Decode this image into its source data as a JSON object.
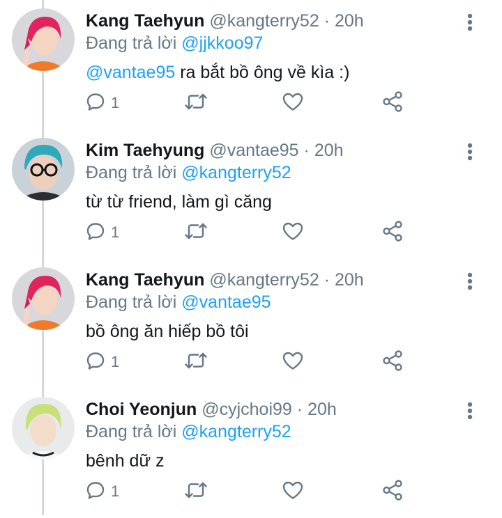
{
  "colors": {
    "text": "#14171a",
    "secondary": "#657786",
    "mention": "#1da1f2",
    "thread_line": "#cfd9de",
    "icon": "#657786"
  },
  "tweets": [
    {
      "name": "Kang Taehyun",
      "handle": "@kangterry52",
      "dot": "·",
      "time": "20h",
      "reply_prefix": "Đang trả lời",
      "reply_to": "@jjkkoo97",
      "body_mention": "@vantae95",
      "body": " ra bắt bồ ông về kìa :)",
      "reply_count": "1",
      "avatar": "red-hair-orange-shirt"
    },
    {
      "name": "Kim Taehyung",
      "handle": "@vantae95",
      "dot": "·",
      "time": "20h",
      "reply_prefix": "Đang trả lời",
      "reply_to": "@kangterry52",
      "body_mention": "",
      "body": "từ từ friend, làm gì căng",
      "reply_count": "1",
      "avatar": "blue-hair-glasses"
    },
    {
      "name": "Kang Taehyun",
      "handle": "@kangterry52",
      "dot": "·",
      "time": "20h",
      "reply_prefix": "Đang trả lời",
      "reply_to": "@vantae95",
      "body_mention": "",
      "body": "bồ ông ăn hiếp bồ tôi",
      "reply_count": "1",
      "avatar": "red-hair-orange-shirt"
    },
    {
      "name": "Choi Yeonjun",
      "handle": "@cyjchoi99",
      "dot": "·",
      "time": "20h",
      "reply_prefix": "Đang trả lời",
      "reply_to": "@kangterry52",
      "body_mention": "",
      "body": "bênh dữ z",
      "reply_count": "1",
      "avatar": "green-hair-white-shirt"
    }
  ]
}
